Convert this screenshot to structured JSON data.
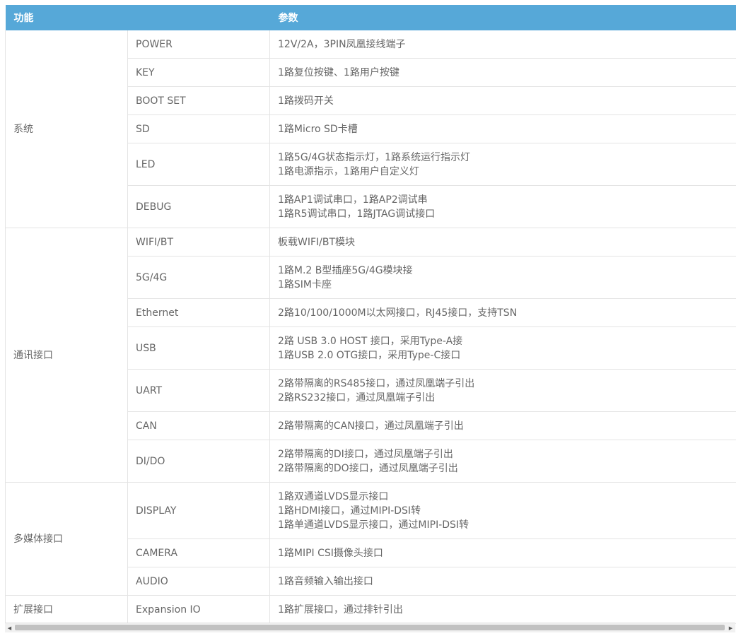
{
  "header": {
    "function": "功能",
    "params": "参数"
  },
  "groups": [
    {
      "name": "系统",
      "rows": [
        {
          "item": "POWER",
          "params": [
            "12V/2A，3PIN凤凰接线端子"
          ]
        },
        {
          "item": "KEY",
          "params": [
            "1路复位按键、1路用户按键"
          ]
        },
        {
          "item": "BOOT SET",
          "params": [
            "1路拨码开关"
          ]
        },
        {
          "item": "SD",
          "params": [
            "1路Micro SD卡槽"
          ]
        },
        {
          "item": "LED",
          "params": [
            "1路5G/4G状态指示灯，1路系统运行指示灯",
            "1路电源指示，1路用户自定义灯"
          ]
        },
        {
          "item": "DEBUG",
          "params": [
            "1路AP1调试串口，1路AP2调试串",
            "1路R5调试串口，1路JTAG调试接口"
          ]
        }
      ]
    },
    {
      "name": "通讯接口",
      "rows": [
        {
          "item": "WIFI/BT",
          "params": [
            "板载WIFI/BT模块"
          ]
        },
        {
          "item": "5G/4G",
          "params": [
            "1路M.2 B型插座5G/4G模块接",
            "1路SIM卡座"
          ]
        },
        {
          "item": "Ethernet",
          "params": [
            "2路10/100/1000M以太网接口，RJ45接口，支持TSN"
          ]
        },
        {
          "item": "USB",
          "params": [
            "2路 USB 3.0 HOST 接口，采用Type-A接",
            "1路USB 2.0 OTG接口，采用Type-C接口"
          ]
        },
        {
          "item": "UART",
          "params": [
            "2路带隔离的RS485接口，通过凤凰端子引出",
            "2路RS232接口，通过凤凰端子引出"
          ]
        },
        {
          "item": "CAN",
          "params": [
            "2路带隔离的CAN接口，通过凤凰端子引出"
          ]
        },
        {
          "item": "DI/DO",
          "params": [
            "2路带隔离的DI接口，通过凤凰端子引出",
            "2路带隔离的DO接口，通过凤凰端子引出"
          ]
        }
      ]
    },
    {
      "name": "多媒体接口",
      "rows": [
        {
          "item": "DISPLAY",
          "params": [
            "1路双通道LVDS显示接口",
            "1路HDMI接口，通过MIPI-DSI转",
            "1路单通道LVDS显示接口，通过MIPI-DSI转"
          ]
        },
        {
          "item": "CAMERA",
          "params": [
            "1路MIPI CSI摄像头接口"
          ]
        },
        {
          "item": "AUDIO",
          "params": [
            "1路音频输入输出接口"
          ]
        }
      ]
    },
    {
      "name": "扩展接口",
      "rows": [
        {
          "item": "Expansion IO",
          "params": [
            "1路扩展接口，通过排针引出"
          ]
        }
      ]
    }
  ],
  "scrollbar": {
    "left_arrow": "◀",
    "right_arrow": "▶"
  },
  "colors": {
    "header_bg": "#56a8d8",
    "header_text": "#ffffff",
    "border": "#e4e4e4",
    "text": "#666666"
  }
}
